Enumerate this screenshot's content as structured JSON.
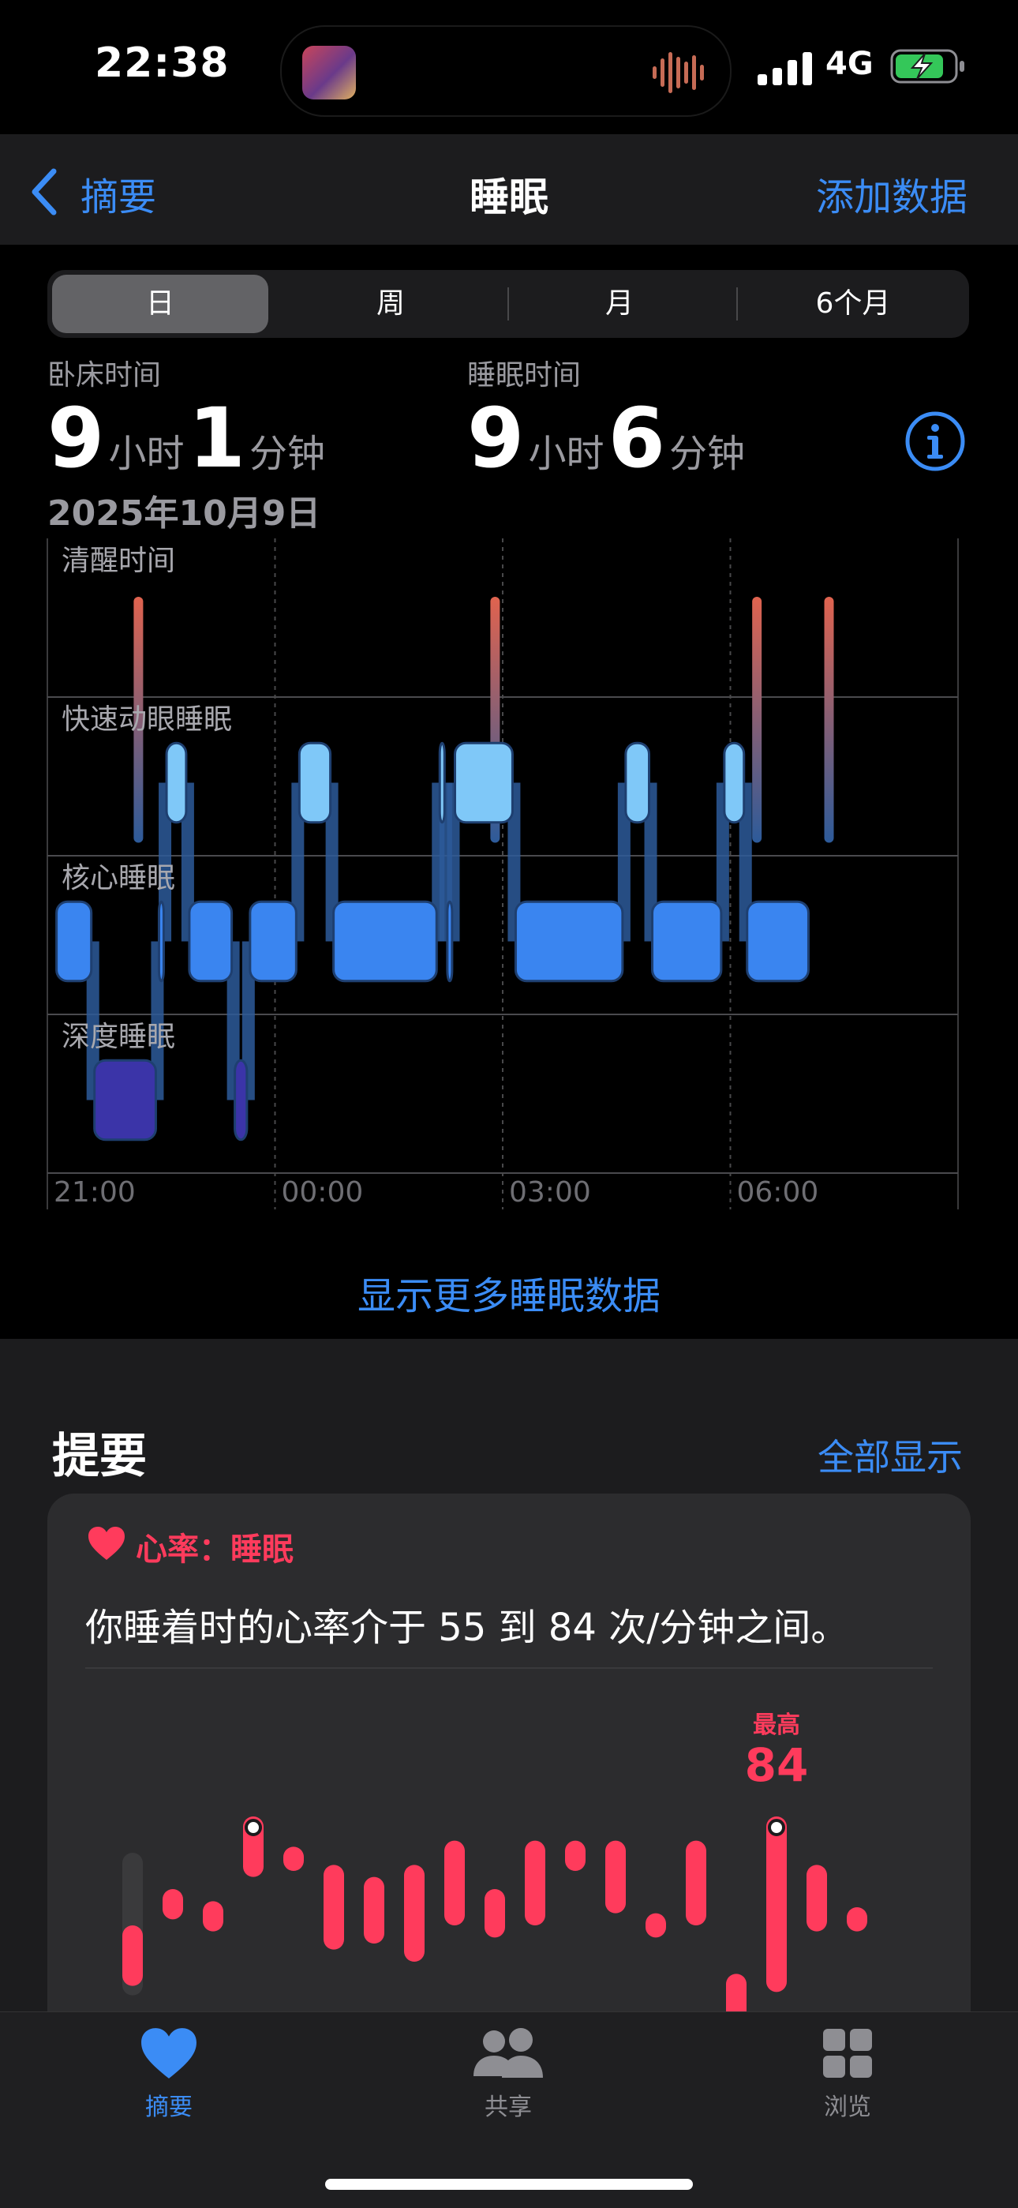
{
  "status": {
    "time": "22:38",
    "network": "4G"
  },
  "nav": {
    "back_label": "摘要",
    "title": "睡眠",
    "action_label": "添加数据"
  },
  "segments": [
    "日",
    "周",
    "月",
    "6个月"
  ],
  "selected_segment": "日",
  "in_bed": {
    "label": "卧床时间",
    "hours": "9",
    "hours_unit": "小时",
    "minutes": "1",
    "minutes_unit": "分钟"
  },
  "asleep": {
    "label": "睡眠时间",
    "hours": "9",
    "hours_unit": "小时",
    "minutes": "6",
    "minutes_unit": "分钟"
  },
  "date": "2025年10月9日",
  "chart_data": {
    "type": "sleep-stages",
    "stages": [
      "清醒时间",
      "快速动眼睡眠",
      "核心睡眠",
      "深度睡眠"
    ],
    "x_ticks": [
      "21:00",
      "00:00",
      "03:00",
      "06:00"
    ],
    "x_start_hours": 21,
    "segments": [
      {
        "stage": "核心睡眠",
        "start": 0.1,
        "end": 0.6
      },
      {
        "stage": "深度睡眠",
        "start": 0.6,
        "end": 1.45
      },
      {
        "stage": "核心睡眠",
        "start": 1.45,
        "end": 1.55
      },
      {
        "stage": "快速动眼睡眠",
        "start": 1.55,
        "end": 1.85
      },
      {
        "stage": "核心睡眠",
        "start": 1.85,
        "end": 2.45
      },
      {
        "stage": "深度睡眠",
        "start": 2.45,
        "end": 2.65
      },
      {
        "stage": "核心睡眠",
        "start": 2.65,
        "end": 3.3
      },
      {
        "stage": "快速动眼睡眠",
        "start": 3.3,
        "end": 3.75
      },
      {
        "stage": "核心睡眠",
        "start": 3.75,
        "end": 5.15
      },
      {
        "stage": "快速动眼睡眠",
        "start": 5.15,
        "end": 5.25
      },
      {
        "stage": "核心睡眠",
        "start": 5.25,
        "end": 5.35
      },
      {
        "stage": "快速动眼睡眠",
        "start": 5.35,
        "end": 6.15
      },
      {
        "stage": "核心睡眠",
        "start": 6.15,
        "end": 7.6
      },
      {
        "stage": "快速动眼睡眠",
        "start": 7.6,
        "end": 7.95
      },
      {
        "stage": "核心睡眠",
        "start": 7.95,
        "end": 8.9
      },
      {
        "stage": "快速动眼睡眠",
        "start": 8.9,
        "end": 9.2
      },
      {
        "stage": "核心睡眠",
        "start": 9.2,
        "end": 10.05
      }
    ],
    "awake_marks": [
      1.2,
      5.9,
      9.35,
      10.3
    ]
  },
  "more_data_label": "显示更多睡眠数据",
  "highlights": {
    "title": "提要",
    "show_all": "全部显示",
    "card": {
      "category": "心率：睡眠",
      "text": "你睡着时的心率介于 55 到 84 次/分钟之间。",
      "max_label": "最高",
      "max_value": "84"
    },
    "hr_chart": {
      "type": "range-bar",
      "unit": "次/分钟",
      "max": 84,
      "ranges": [
        [
          56,
          66
        ],
        [
          67,
          72
        ],
        [
          65,
          70
        ],
        [
          74,
          84
        ],
        [
          75,
          79
        ],
        [
          62,
          76
        ],
        [
          63,
          74
        ],
        [
          60,
          76
        ],
        [
          66,
          80
        ],
        [
          64,
          72
        ],
        [
          66,
          80
        ],
        [
          75,
          80
        ],
        [
          68,
          80
        ],
        [
          64,
          68
        ],
        [
          66,
          80
        ],
        [
          50,
          58
        ],
        [
          55,
          84
        ],
        [
          65,
          76
        ],
        [
          65,
          69
        ]
      ]
    }
  },
  "tabs": [
    {
      "label": "摘要",
      "icon": "heart-icon",
      "active": true
    },
    {
      "label": "共享",
      "icon": "people-icon",
      "active": false
    },
    {
      "label": "浏览",
      "icon": "grid-icon",
      "active": false
    }
  ],
  "colors": {
    "accent": "#3b8cf5",
    "awake": "#e0634f",
    "rem": "#7fc8f8",
    "core": "#3a85f0",
    "deep": "#3b34a8",
    "heart": "#ff3b5c"
  }
}
